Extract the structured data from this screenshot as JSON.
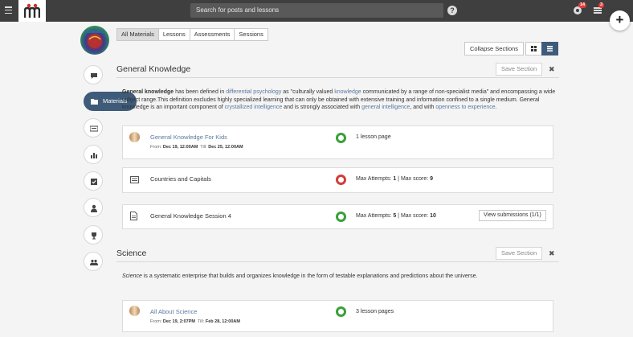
{
  "search": {
    "placeholder": "Search for posts and lessons"
  },
  "badges": {
    "notifications": "14",
    "messages": "3"
  },
  "filter_tabs": [
    "All Materials",
    "Lessons",
    "Assessments",
    "Sessions"
  ],
  "toolbar": {
    "collapse_label": "Collapse Sections"
  },
  "nav": {
    "active_label": "Materials"
  },
  "sections": [
    {
      "title": "General Knowledge",
      "save_label": "Save Section",
      "close": "✖",
      "description": {
        "bold": "General knowledge",
        "t1": " has been defined in ",
        "l1": "differential psychology",
        "t2": " as \"culturally valued ",
        "l2": "knowledge",
        "t3": " communicated by a range of non-specialist media\" and encompassing a wide subject range.This definition excludes highly specialized learning that can only be obtained with extensive training and information confined to a single medium. General knowledge is an important component of ",
        "l3": "crystallized intelligence",
        "t4": " and is strongly associated with ",
        "l4": "general intelligence",
        "t5": ", and with ",
        "l5": "openness to experience",
        "t6": "."
      },
      "items": [
        {
          "title": "General Knowledge For Kids",
          "from_label": "From:",
          "from": "Dec 19, 12:00AM",
          "till_label": "Till:",
          "till": "Dec 25, 12:00AM",
          "meta": "1 lesson page",
          "status": "green"
        },
        {
          "title": "Countries and Capitals",
          "attempts_label": "Max Attempts:",
          "attempts": "1",
          "sep": "|",
          "score_label": "Max score:",
          "score": "9",
          "status": "red"
        },
        {
          "title": "General Knowledge Session 4",
          "attempts_label": "Max Attempts:",
          "attempts": "5",
          "sep": "|",
          "score_label": "Max score:",
          "score": "10",
          "status": "green",
          "action": "View submissions (1/1)"
        }
      ]
    },
    {
      "title": "Science",
      "save_label": "Save Section",
      "close": "✖",
      "description": {
        "italic": "Science",
        "rest": " is a systematic enterprise that builds and organizes knowledge in the form of testable explanations and predictions about the universe."
      },
      "items": [
        {
          "title": "All About Science",
          "from_label": "From:",
          "from": "Dec 19, 2:07PM",
          "till_label": "Till:",
          "till": "Feb 28, 12:00AM",
          "meta": "3 lesson pages",
          "status": "green"
        }
      ]
    }
  ],
  "colors": {
    "topbar": "#3f3f3f",
    "accent": "#3e5b7a",
    "link": "#5a78a0",
    "green": "#3aa03a",
    "red": "#d33c3c",
    "badge": "#e13b3b"
  }
}
